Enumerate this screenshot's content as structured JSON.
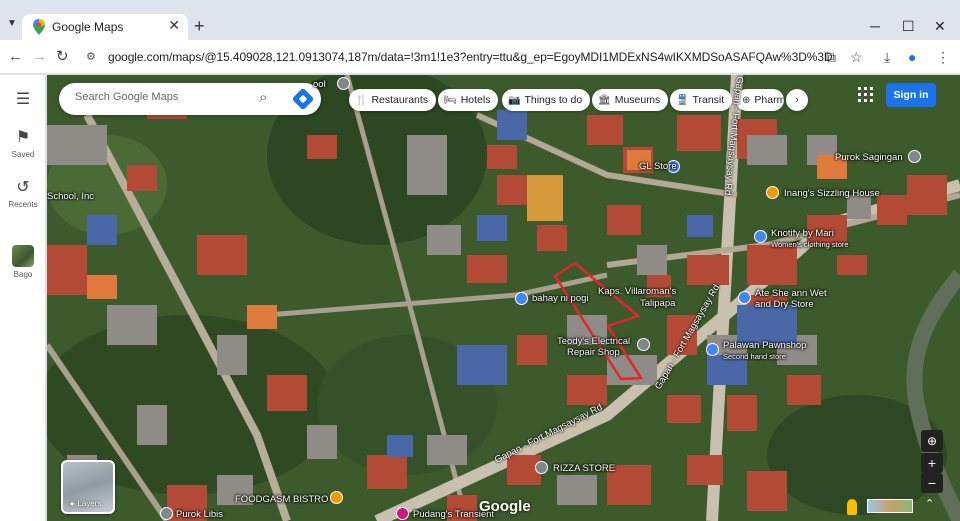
{
  "browser": {
    "tab_title": "Google Maps",
    "tab_close": "✕",
    "new_tab": "+",
    "url": "google.com/maps/@15.409028,121.0913074,187m/data=!3m1!1e3?entry=ttu&g_ep=EgoyMDI1MDExNS4wIKXMDSoASAFQAw%3D%3D",
    "controls": {
      "minimize": "─",
      "maximize": "☐",
      "close": "✕"
    }
  },
  "rail": {
    "menu_icon": "☰",
    "saved_label": "Saved",
    "recents_label": "Recents",
    "bago_label": "Bago"
  },
  "search": {
    "placeholder": "Search Google Maps"
  },
  "chips": [
    {
      "label": "Restaurants",
      "icon": "🍴"
    },
    {
      "label": "Hotels",
      "icon": "🛏"
    },
    {
      "label": "Things to do",
      "icon": "📷"
    },
    {
      "label": "Museums",
      "icon": "🏛"
    },
    {
      "label": "Transit",
      "icon": "🚆"
    },
    {
      "label": "Pharma",
      "icon": "⊕"
    }
  ],
  "signin_label": "Sign in",
  "places": {
    "school": "ool",
    "school_inc": "School, Inc",
    "gl_store": "GL Store",
    "purok_sagingan": "Purok Sagingan",
    "inangs": "Inang's Sizzling House",
    "knotify": "Knotify by Mari",
    "knotify_sub": "Women's clothing store",
    "bahay": "bahay ni pogi",
    "villaroman": "Kaps. Villaroman's",
    "talipapa": "Talipapa",
    "ate_she": "Ate She ann Wet",
    "ate_she2": "and Dry Store",
    "teody": "Teody's Electrical",
    "teody2": "Repair Shop",
    "palawan": "Palawan Pawnshop",
    "palawan_sub": "Second hand store",
    "rizza": "RIZZA STORE",
    "foodgasm": "FOODGASM BISTRO",
    "purok_libis": "Purok Libis",
    "pudang": "Pudang's Transient"
  },
  "roads": {
    "fort_v": "Gapan - Fort Magsaysay Rd",
    "fort_v2": "Gapan - Fort Magsaysay Rd",
    "fort_h": "Gapan - Fort Magsaysay Rd"
  },
  "layers_label": "Layers",
  "google_logo": "Google",
  "zoom": {
    "in": "+",
    "out": "−"
  },
  "colors": {
    "accent": "#1a73e8",
    "boundary": "#e3262e"
  }
}
